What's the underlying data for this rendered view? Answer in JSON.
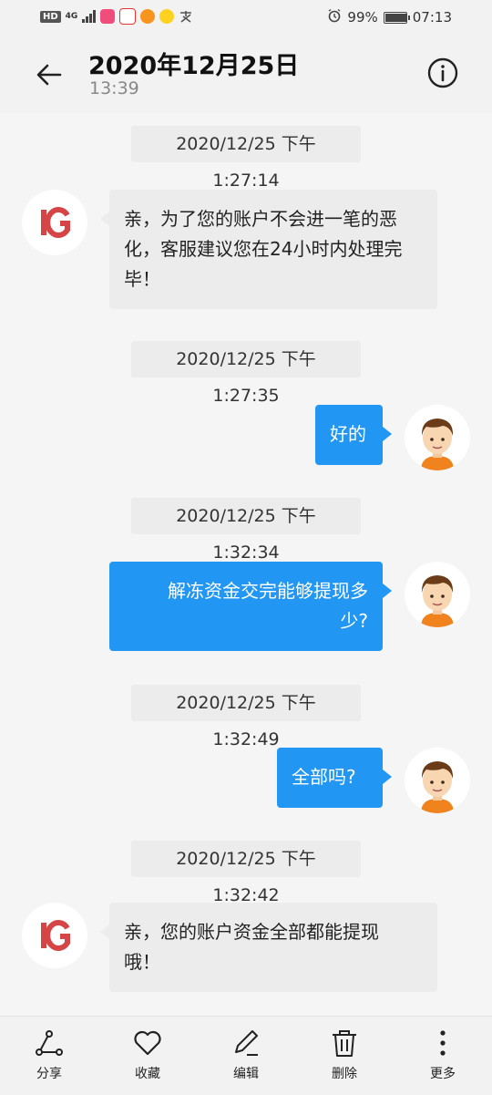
{
  "status_bar": {
    "hd": "HD",
    "network": "4G",
    "battery": "99%",
    "battery_level": 0.99,
    "time": "07:13"
  },
  "header": {
    "title": "2020年12月25日",
    "subtitle": "13:39"
  },
  "messages": [
    {
      "type": "timestamp",
      "text": "2020/12/25 下午1:27:14"
    },
    {
      "type": "incoming",
      "avatar": "IG",
      "lines": [
        "亲，为了您的账户不会进一笔的恶",
        "化，客服建议您在24小时内处理完",
        "毕！"
      ]
    },
    {
      "type": "timestamp",
      "text": "2020/12/25 下午1:27:35"
    },
    {
      "type": "outgoing",
      "lines": [
        "好的"
      ]
    },
    {
      "type": "timestamp",
      "text": "2020/12/25 下午1:32:34"
    },
    {
      "type": "outgoing",
      "lines": [
        "解冻资金交完能够提现多",
        "少?"
      ]
    },
    {
      "type": "timestamp",
      "text": "2020/12/25 下午1:32:49"
    },
    {
      "type": "outgoing",
      "lines": [
        "全部吗?"
      ]
    },
    {
      "type": "timestamp",
      "text": "2020/12/25 下午1:32:42"
    },
    {
      "type": "incoming",
      "avatar": "IG",
      "lines": [
        "亲，您的账户资金全部都能提现",
        "哦！"
      ]
    }
  ],
  "toolbar": {
    "share": "分享",
    "favorite": "收藏",
    "edit": "编辑",
    "delete": "删除",
    "more": "更多"
  },
  "colors": {
    "accent": "#2196f3",
    "incoming_bubble": "#ececec",
    "background": "#f5f5f5"
  }
}
